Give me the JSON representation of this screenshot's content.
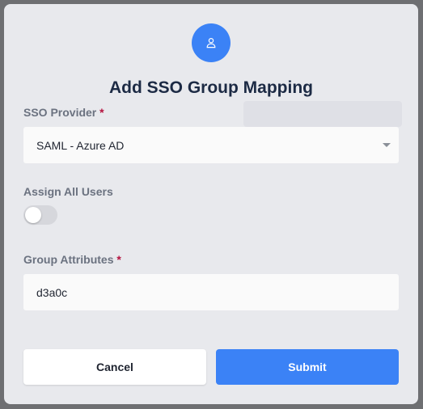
{
  "modal": {
    "title": "Add SSO Group Mapping",
    "avatar_icon": "user-icon",
    "accent_color": "#3b82f6"
  },
  "fields": {
    "sso_provider": {
      "label": "SSO Provider",
      "required_mark": "*",
      "value": "SAML - Azure AD"
    },
    "assign_all_users": {
      "label": "Assign All Users",
      "enabled": false
    },
    "group_attributes": {
      "label": "Group Attributes",
      "required_mark": "*",
      "value": "d3a0c"
    }
  },
  "actions": {
    "cancel_label": "Cancel",
    "submit_label": "Submit"
  }
}
